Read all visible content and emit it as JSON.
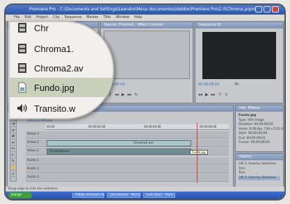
{
  "window": {
    "title": "Premiere Pro - C:\\Documents and Settings\\Leandro\\Meus documentos\\Adobe\\Premiere Pro\\2.0\\Chroma.prproj *"
  },
  "menu": [
    "File",
    "Edit",
    "Project",
    "Clip",
    "Sequence",
    "Marker",
    "Title",
    "Window",
    "Help"
  ],
  "project_panel": {
    "tab": "Project: Chroma",
    "items": [
      {
        "name": "Chr",
        "icon": "film-icon"
      },
      {
        "name": "Chroma1.",
        "icon": "film-icon"
      },
      {
        "name": "Chroma2.av",
        "icon": "film-icon"
      },
      {
        "name": "Fundo.jpg",
        "icon": "image-file-icon",
        "selected": true
      },
      {
        "name": "Transito.w",
        "icon": "audio-speaker-icon"
      }
    ]
  },
  "source_monitor": {
    "tabs": [
      "Source: Chroma1",
      "Effect Controls"
    ],
    "timecode": "00:00:00:00"
  },
  "program_monitor": {
    "tab": "Sequence 01",
    "timecode": "00;00;06;02",
    "fit": "Fit"
  },
  "timeline": {
    "tab": "Timeline",
    "sequence_tab": "Sequence 01",
    "timecode": "00;00;06;02",
    "ruler": [
      "00;00",
      "00;00;02;00",
      "00;00;04;00",
      "00;00;06;00"
    ],
    "tracks": [
      "Video 3",
      "Video 2",
      "Video 1",
      "Audio 1",
      "Audio 2",
      "Audio 3"
    ],
    "clips": {
      "video2": "Chroma2.avi",
      "video1": "Chroma2.avi",
      "tooltip": "Fundo.jpg"
    }
  },
  "info_panel": {
    "tabs": [
      "Info",
      "Effects"
    ],
    "lines": [
      "Fundo.jpg",
      "Type: Still Image",
      "Duration: 00;00;06;02",
      "Video: 0,00 fps, 720 x 510 (0,9091)",
      "",
      "Start: 00;00;00;00",
      "End: 00;00;06;01",
      "Cursor: 00;00;06;02"
    ]
  },
  "history_panel": {
    "tab": "History",
    "items": [
      "Lift 3: Overlay Selection",
      "Trim",
      "Trim",
      "Lift 3: Overlay Selection"
    ]
  },
  "statusbar": "Drag edge to trim the selection.",
  "taskbar": {
    "start": "Iniciar",
    "items": [
      "Adobe Premiere Pro",
      "Documento - Microsoft",
      "Sem título - Paint"
    ]
  }
}
